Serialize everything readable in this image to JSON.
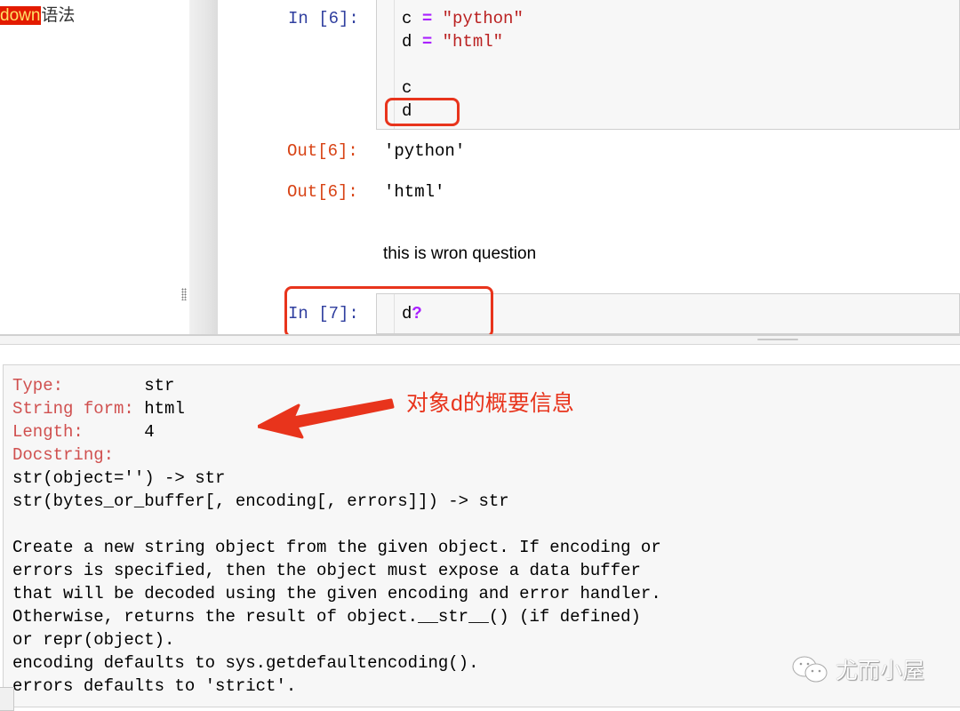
{
  "sidebar": {
    "toc_item": {
      "highlighted": "down",
      "rest": "语法"
    }
  },
  "cells": {
    "cell6": {
      "in_prompt": "In [6]:",
      "code": {
        "line1": {
          "var": "c",
          "op": "=",
          "value": "\"python\""
        },
        "line2": {
          "var": "d",
          "op": "=",
          "value": "\"html\""
        },
        "line4": "c",
        "line5": "d"
      },
      "outputs": [
        {
          "prompt": "Out[6]:",
          "value": "'python'"
        },
        {
          "prompt": "Out[6]:",
          "value": "'html'"
        }
      ]
    },
    "markdown": {
      "text": "this is wron question"
    },
    "cell7": {
      "in_prompt": "In [7]:",
      "code": {
        "var": "d",
        "suffix": "?"
      }
    }
  },
  "pager": {
    "fields": [
      {
        "key": "Type:        ",
        "value": "str"
      },
      {
        "key": "String form: ",
        "value": "html"
      },
      {
        "key": "Length:      ",
        "value": "4"
      },
      {
        "key": "Docstring:",
        "value": ""
      }
    ],
    "doc_lines": [
      "str(object='') -> str",
      "str(bytes_or_buffer[, encoding[, errors]]) -> str",
      "",
      "Create a new string object from the given object. If encoding or",
      "errors is specified, then the object must expose a data buffer",
      "that will be decoded using the given encoding and error handler.",
      "Otherwise, returns the result of object.__str__() (if defined)",
      "or repr(object).",
      "encoding defaults to sys.getdefaultencoding().",
      "errors defaults to 'strict'."
    ]
  },
  "annotation": {
    "text": "对象d的概要信息",
    "color": "#e8341c"
  },
  "watermark": {
    "text": "尤而小屋",
    "icon": "wechat-icon"
  }
}
